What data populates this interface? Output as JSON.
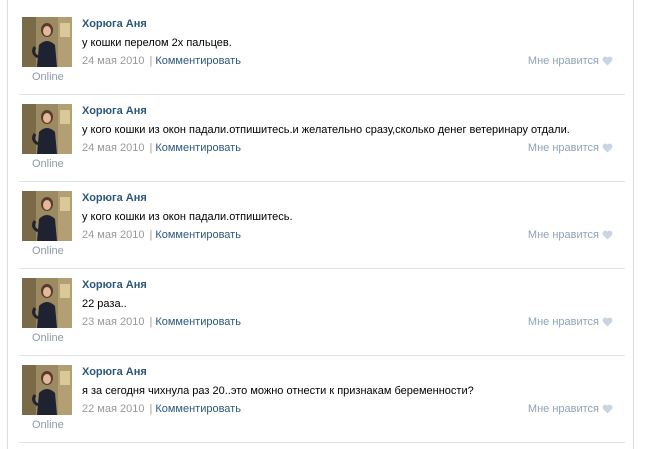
{
  "posts": [
    {
      "author": "Хорюга Аня",
      "text": "у кошки перелом 2х пальцев.",
      "date": "24 мая 2010",
      "comment_label": "Комментировать",
      "like_label": "Мне нравится",
      "status": "Online"
    },
    {
      "author": "Хорюга Аня",
      "text": "у кого кошки из окон падали.отпишитесь.и желательно сразу,сколько денег ветеринару отдали.",
      "date": "24 мая 2010",
      "comment_label": "Комментировать",
      "like_label": "Мне нравится",
      "status": "Online"
    },
    {
      "author": "Хорюга Аня",
      "text": "у кого кошки из окон падали.отпишитесь.",
      "date": "24 мая 2010",
      "comment_label": "Комментировать",
      "like_label": "Мне нравится",
      "status": "Online"
    },
    {
      "author": "Хорюга Аня",
      "text": "22 раза..",
      "date": "23 мая 2010",
      "comment_label": "Комментировать",
      "like_label": "Мне нравится",
      "status": "Online"
    },
    {
      "author": "Хорюга Аня",
      "text": "я за сегодня чихнула раз 20..это можно отнести к признакам беременности?",
      "date": "22 мая 2010",
      "comment_label": "Комментировать",
      "like_label": "Мне нравится",
      "status": "Online"
    }
  ],
  "colors": {
    "link": "#2b587a",
    "muted": "#999999",
    "like": "#8ea3b6",
    "divider": "#dee3ea"
  },
  "icons": {
    "like": "heart-icon",
    "avatar": "avatar-photo"
  }
}
